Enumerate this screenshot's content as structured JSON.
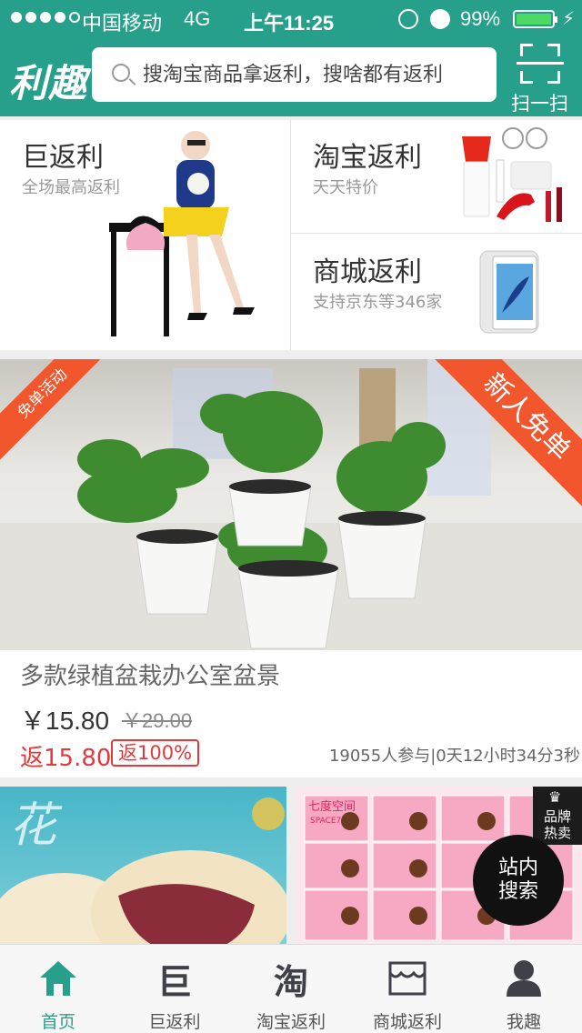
{
  "status_bar": {
    "carrier": "中国移动",
    "network": "4G",
    "time": "上午11:25",
    "battery": "99%",
    "battery_level": 0.99
  },
  "header": {
    "logo": "利趣",
    "search_placeholder": "搜淘宝商品拿返利，搜啥都有返利",
    "scan_label": "扫一扫"
  },
  "categories": [
    {
      "title": "巨返利",
      "subtitle": "全场最高返利"
    },
    {
      "title": "淘宝返利",
      "subtitle": "天天特价"
    },
    {
      "title": "商城返利",
      "subtitle": "支持京东等346家"
    }
  ],
  "featured": {
    "ribbon_left": "免单活动",
    "ribbon_right": "新人免单",
    "title": "多款绿植盆栽办公室盆景",
    "price": "￥15.80",
    "original_price": "￥29.00",
    "rebate": "返15.80",
    "rebate_percent": "返100%",
    "meta": "19055人参与|0天12小时34分3秒"
  },
  "tiles": [
    {
      "brand_line1": "七度空间",
      "brand_line2": "SPACE7"
    }
  ],
  "brand_badge": {
    "line1": "品牌",
    "line2": "热卖"
  },
  "floating_button": {
    "line1": "站内",
    "line2": "搜索"
  },
  "tabbar": [
    {
      "label": "首页",
      "icon": "home-icon"
    },
    {
      "label": "巨返利",
      "icon": "巨"
    },
    {
      "label": "淘宝返利",
      "icon": "淘"
    },
    {
      "label": "商城返利",
      "icon": "store-icon"
    },
    {
      "label": "我趣",
      "icon": "user-icon"
    }
  ],
  "colors": {
    "brand": "#26a08a",
    "accent_red": "#e4393c",
    "ribbon": "#f2562c"
  }
}
